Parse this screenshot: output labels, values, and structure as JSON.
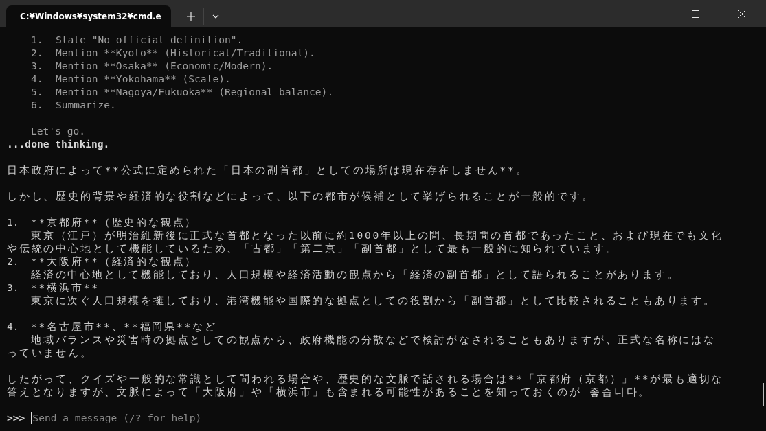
{
  "tabs": [
    {
      "title": "C:¥Windows¥system32¥cmd.e",
      "selected": true
    }
  ],
  "lines": [
    {
      "kind": "thinking_item",
      "number": "1.",
      "text": "State \"No official definition\"."
    },
    {
      "kind": "thinking_item",
      "number": "2.",
      "text": "Mention **Kyoto** (Historical/Traditional)."
    },
    {
      "kind": "thinking_item",
      "number": "3.",
      "text": "Mention **Osaka** (Economic/Modern)."
    },
    {
      "kind": "thinking_item",
      "number": "4.",
      "text": "Mention **Yokohama** (Scale)."
    },
    {
      "kind": "thinking_item",
      "number": "5.",
      "text": "Mention **Nagoya/Fukuoka** (Regional balance)."
    },
    {
      "kind": "thinking_item",
      "number": "6.",
      "text": "Summarize."
    },
    {
      "kind": "thinking",
      "text": "Let's go.",
      "space_before": true
    },
    {
      "kind": "status",
      "text": "...done thinking."
    },
    {
      "kind": "text",
      "text": "日本政府によって**公式に定められた「日本の副首都」としての場所は現在存在しません**。",
      "space_before": true
    },
    {
      "kind": "text",
      "text": "しかし、歴史的背景や経済的な役割などによって、以下の都市が候補として挙げられることが一般的です。",
      "space_before": true
    },
    {
      "kind": "item",
      "number": "1.",
      "text": "**京都府**（歴史的な観点）",
      "space_before": true
    },
    {
      "kind": "item_body",
      "text": "東京（江戸）が明治維新後に正式な首都となった以前に約1000年以上の間、長期間の首都であったこと、および現在でも文化"
    },
    {
      "kind": "text",
      "text": "や伝統の中心地として機能しているため、「古都」「第二京」「副首都」として最も一般的に知られています。"
    },
    {
      "kind": "item",
      "number": "2.",
      "text": "**大阪府**（経済的な観点）"
    },
    {
      "kind": "item_body",
      "text": "経済の中心地として機能しており、人口規模や経済活動の観点から「経済の副首都」として語られることがあります。"
    },
    {
      "kind": "item",
      "number": "3.",
      "text": "**横浜市**"
    },
    {
      "kind": "item_body",
      "text": "東京に次ぐ人口規模を擁しており、港湾機能や国際的な拠点としての役割から「副首都」として比較されることもあります。"
    },
    {
      "kind": "item",
      "number": "4.",
      "text": "**名古屋市**、**福岡県**など",
      "space_before": true
    },
    {
      "kind": "item_body",
      "text": "地域バランスや災害時の拠点としての観点から、政府機能の分散などで検討がなされることもありますが、正式な名称にはな"
    },
    {
      "kind": "text",
      "text": "っていません。"
    },
    {
      "kind": "text",
      "text": "したがって、クイズや一般的な常識として問われる場合や、歴史的な文脈で話される場合は**「京都府（京都）」**が最も適切な",
      "space_before": true
    },
    {
      "kind": "text",
      "text": "答えとなりますが、文脈によって「大阪府」や「横浜市」も含まれる可能性があることを知っておくのが 좋습니다。"
    }
  ],
  "prompt": {
    "symbol": ">>>",
    "placeholder": "Send a message (/? for help)"
  }
}
